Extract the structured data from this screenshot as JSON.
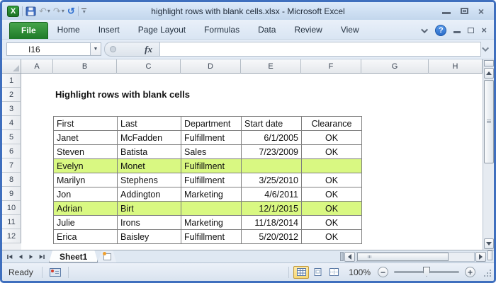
{
  "window": {
    "title": "highlight rows with blank cells.xlsx  -  Microsoft Excel"
  },
  "ribbon": {
    "tabs": [
      {
        "label": "File",
        "active": true
      },
      {
        "label": "Home"
      },
      {
        "label": "Insert"
      },
      {
        "label": "Page Layout"
      },
      {
        "label": "Formulas"
      },
      {
        "label": "Data"
      },
      {
        "label": "Review"
      },
      {
        "label": "View"
      }
    ]
  },
  "formula_bar": {
    "name_box": "I16",
    "fx_label": "fx",
    "formula": ""
  },
  "grid": {
    "column_headers": [
      "A",
      "B",
      "C",
      "D",
      "E",
      "F",
      "G",
      "H"
    ],
    "row_headers": [
      "1",
      "2",
      "3",
      "4",
      "5",
      "6",
      "7",
      "8",
      "9",
      "10",
      "11",
      "12"
    ]
  },
  "sheet": {
    "doc_title": "Highlight rows with blank cells",
    "highlight_color": "#d9f882",
    "table": {
      "headers": [
        "First",
        "Last",
        "Department",
        "Start date",
        "Clearance"
      ],
      "rows": [
        {
          "cells": [
            "Janet",
            "McFadden",
            "Fulfillment",
            "6/1/2005",
            "OK"
          ],
          "highlight": false
        },
        {
          "cells": [
            "Steven",
            "Batista",
            "Sales",
            "7/23/2009",
            "OK"
          ],
          "highlight": false
        },
        {
          "cells": [
            "Evelyn",
            "Monet",
            "Fulfillment",
            "",
            ""
          ],
          "highlight": true
        },
        {
          "cells": [
            "Marilyn",
            "Stephens",
            "Fulfillment",
            "3/25/2010",
            "OK"
          ],
          "highlight": false
        },
        {
          "cells": [
            "Jon",
            "Addington",
            "Marketing",
            "4/6/2011",
            "OK"
          ],
          "highlight": false
        },
        {
          "cells": [
            "Adrian",
            "Birt",
            "",
            "12/1/2015",
            "OK"
          ],
          "highlight": true
        },
        {
          "cells": [
            "Julie",
            "Irons",
            "Marketing",
            "11/18/2014",
            "OK"
          ],
          "highlight": false
        },
        {
          "cells": [
            "Erica",
            "Baisley",
            "Fulfillment",
            "5/20/2012",
            "OK"
          ],
          "highlight": false
        }
      ]
    }
  },
  "sheet_tabs": {
    "active": "Sheet1"
  },
  "status_bar": {
    "mode": "Ready",
    "zoom_level": "100%"
  },
  "icons": {
    "qat": [
      "excel-logo",
      "save-icon",
      "undo-icon",
      "redo-icon",
      "repeat-icon",
      "customize-qat-icon"
    ],
    "titlebar": [
      "minimize-icon",
      "restore-icon",
      "close-icon"
    ],
    "ribbon_right": [
      "collapse-ribbon-icon",
      "help-icon",
      "minimize-icon",
      "restore-icon",
      "close-icon"
    ],
    "view_buttons": [
      "normal-view-icon",
      "page-layout-view-icon",
      "page-break-view-icon"
    ]
  }
}
